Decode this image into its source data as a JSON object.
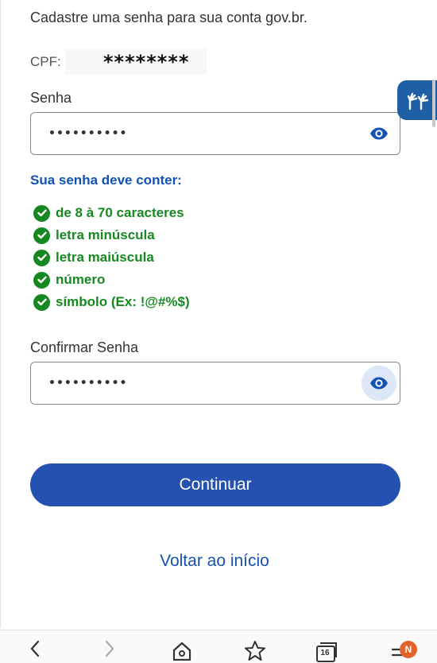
{
  "intro_text": "Cadastre uma senha para sua conta gov.br.",
  "cpf": {
    "label": "CPF:",
    "value": "********"
  },
  "password": {
    "label": "Senha",
    "value": "••••••••••"
  },
  "rules": {
    "title": "Sua senha deve conter:",
    "items": [
      {
        "label": "de 8 à 70 caracteres"
      },
      {
        "label": "letra minúscula"
      },
      {
        "label": "letra maiúscula"
      },
      {
        "label": "número"
      },
      {
        "label": "símbolo (Ex: !@#%$)"
      }
    ]
  },
  "confirm": {
    "label": "Confirmar Senha",
    "value": "••••••••••"
  },
  "buttons": {
    "continue_label": "Continuar",
    "back_label": "Voltar ao início"
  },
  "browser": {
    "tab_count": "16",
    "badge": "N"
  },
  "colors": {
    "primary": "#1351b4",
    "button": "#2551b0",
    "success": "#168821",
    "badge": "#e5622b"
  },
  "icons": [
    "eye-icon",
    "check-circle-icon",
    "vlibras-hands-icon",
    "back-arrow-icon",
    "forward-arrow-icon",
    "home-icon",
    "star-icon",
    "tabs-icon",
    "menu-icon"
  ]
}
